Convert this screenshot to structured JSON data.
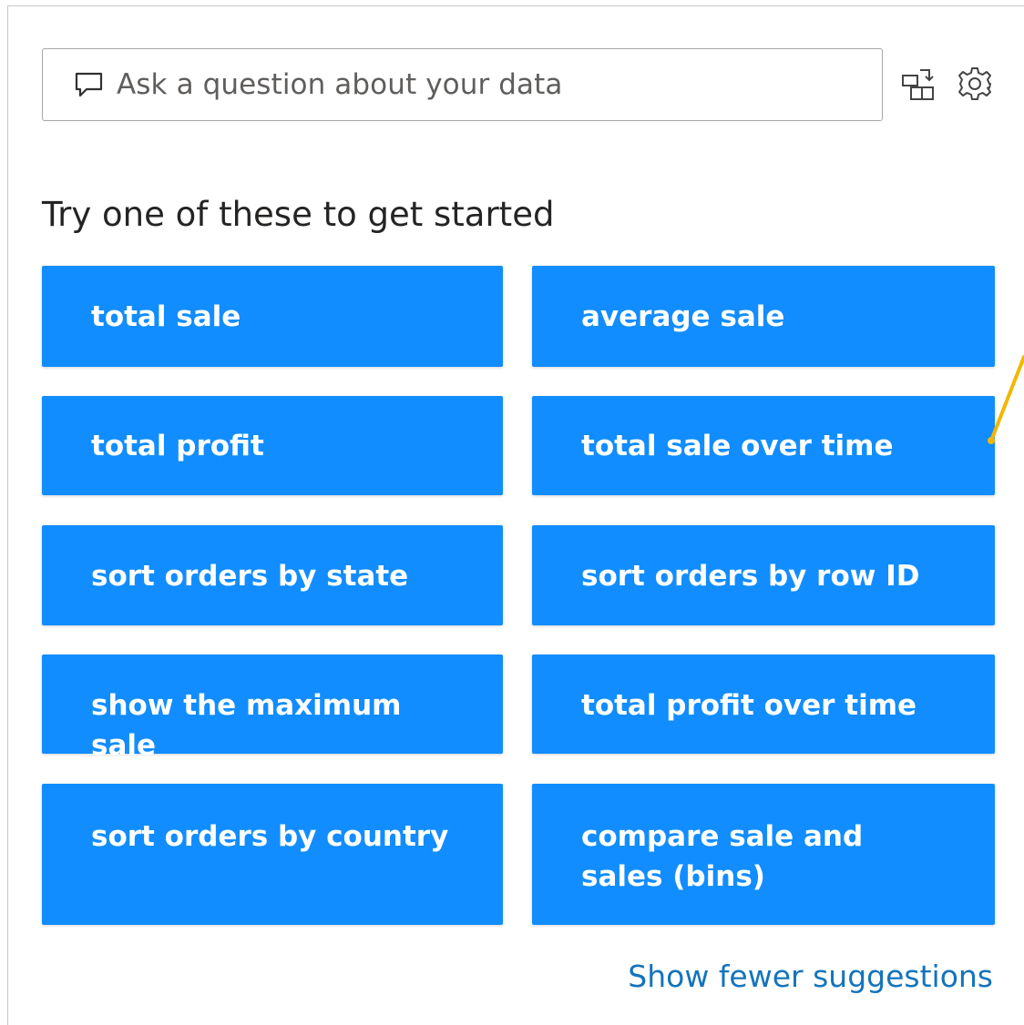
{
  "qa": {
    "placeholder": "Ask a question about your data"
  },
  "toolbar": {
    "icons": [
      "convert-visual-icon",
      "settings-icon"
    ]
  },
  "suggestions": {
    "title": "Try one of these to get started",
    "items": [
      "total sale",
      "average sale",
      "total profit",
      "total sale over time",
      "sort orders by state",
      "sort orders by row ID",
      "show the maximum sale",
      "total profit over time",
      "sort orders by country",
      "compare sale and sales (bins)"
    ],
    "show_fewer_label": "Show fewer suggestions"
  },
  "colors": {
    "accent": "#118dff",
    "link": "#1474bc",
    "callout": "#f2b705"
  }
}
